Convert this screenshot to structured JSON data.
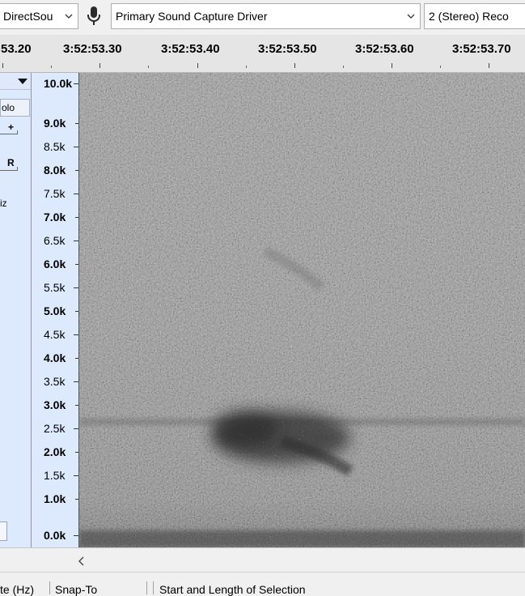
{
  "device_toolbar": {
    "host_combo": "DirectSou",
    "recording_device": "Primary Sound Capture Driver",
    "channels": "2 (Stereo) Reco"
  },
  "timeline": {
    "labels": [
      "53.20",
      "3:52:53.30",
      "3:52:53.40",
      "3:52:53.50",
      "3:52:53.60",
      "3:52:53.70"
    ]
  },
  "track_panel": {
    "solo_label": "olo",
    "gain_plus": "+",
    "pan_right": "R",
    "rate_fragment": "iz"
  },
  "frequency_scale": {
    "labels": [
      "10.0k",
      "9.0k",
      "8.5k",
      "8.0k",
      "7.5k",
      "7.0k",
      "6.5k",
      "6.0k",
      "5.5k",
      "5.0k",
      "4.5k",
      "4.0k",
      "3.5k",
      "3.0k",
      "2.5k",
      "2.0k",
      "1.5k",
      "1.0k",
      "0.0k"
    ]
  },
  "status_bar": {
    "rate_label": "te (Hz)",
    "snap_label": "Snap-To",
    "selection_label": "Start and Length of Selection"
  }
}
